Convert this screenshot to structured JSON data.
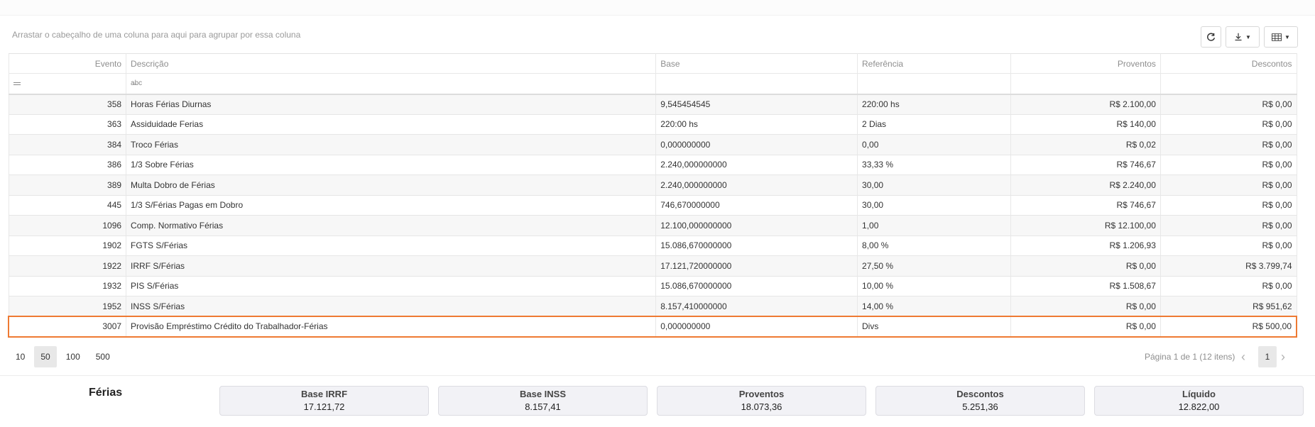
{
  "toolbar": {
    "group_hint": "Arrastar o cabeçalho de uma coluna para aqui para agrupar por essa coluna"
  },
  "columns": {
    "evento": "Evento",
    "descricao": "Descrição",
    "base": "Base",
    "referencia": "Referência",
    "proventos": "Proventos",
    "descontos": "Descontos"
  },
  "rows": [
    {
      "evento": "358",
      "descricao": "Horas Férias Diurnas",
      "base": "9,545454545",
      "referencia": "220:00 hs",
      "proventos": "R$ 2.100,00",
      "descontos": "R$ 0,00"
    },
    {
      "evento": "363",
      "descricao": "Assiduidade Ferias",
      "base": "220:00 hs",
      "referencia": "2 Dias",
      "proventos": "R$ 140,00",
      "descontos": "R$ 0,00"
    },
    {
      "evento": "384",
      "descricao": "Troco Férias",
      "base": "0,000000000",
      "referencia": "0,00",
      "proventos": "R$ 0,02",
      "descontos": "R$ 0,00"
    },
    {
      "evento": "386",
      "descricao": "1/3 Sobre Férias",
      "base": "2.240,000000000",
      "referencia": "33,33 %",
      "proventos": "R$ 746,67",
      "descontos": "R$ 0,00"
    },
    {
      "evento": "389",
      "descricao": "Multa Dobro de Férias",
      "base": "2.240,000000000",
      "referencia": "30,00",
      "proventos": "R$ 2.240,00",
      "descontos": "R$ 0,00"
    },
    {
      "evento": "445",
      "descricao": "1/3 S/Férias Pagas em Dobro",
      "base": "746,670000000",
      "referencia": "30,00",
      "proventos": "R$ 746,67",
      "descontos": "R$ 0,00"
    },
    {
      "evento": "1096",
      "descricao": "Comp. Normativo Férias",
      "base": "12.100,000000000",
      "referencia": "1,00",
      "proventos": "R$ 12.100,00",
      "descontos": "R$ 0,00"
    },
    {
      "evento": "1902",
      "descricao": "FGTS S/Férias",
      "base": "15.086,670000000",
      "referencia": "8,00 %",
      "proventos": "R$ 1.206,93",
      "descontos": "R$ 0,00"
    },
    {
      "evento": "1922",
      "descricao": "IRRF S/Férias",
      "base": "17.121,720000000",
      "referencia": "27,50 %",
      "proventos": "R$ 0,00",
      "descontos": "R$ 3.799,74"
    },
    {
      "evento": "1932",
      "descricao": "PIS S/Férias",
      "base": "15.086,670000000",
      "referencia": "10,00 %",
      "proventos": "R$ 1.508,67",
      "descontos": "R$ 0,00"
    },
    {
      "evento": "1952",
      "descricao": "INSS S/Férias",
      "base": "8.157,410000000",
      "referencia": "14,00 %",
      "proventos": "R$ 0,00",
      "descontos": "R$ 951,62"
    },
    {
      "evento": "3007",
      "descricao": "Provisão Empréstimo Crédito do Trabalhador-Férias",
      "base": "0,000000000",
      "referencia": "Divs",
      "proventos": "R$ 0,00",
      "descontos": "R$ 500,00"
    }
  ],
  "pager": {
    "sizes": [
      "10",
      "50",
      "100",
      "500"
    ],
    "active_size": "50",
    "info": "Página 1 de 1 (12 itens)",
    "current_page": "1"
  },
  "summary": {
    "title": "Férias",
    "cards": [
      {
        "label": "Base IRRF",
        "value": "17.121,72"
      },
      {
        "label": "Base INSS",
        "value": "8.157,41"
      },
      {
        "label": "Proventos",
        "value": "18.073,36"
      },
      {
        "label": "Descontos",
        "value": "5.251,36"
      },
      {
        "label": "Líquido",
        "value": "12.822,00"
      }
    ]
  },
  "colors": {
    "selection": "#ee7a33"
  },
  "icons": {
    "refresh": "refresh-icon",
    "export": "download-icon",
    "chooser": "column-chooser-icon",
    "filter_row_first": "filter-operation-icon",
    "filter_row_second": "text-filter-icon",
    "prev": "chevron-left-icon",
    "next": "chevron-right-icon"
  }
}
